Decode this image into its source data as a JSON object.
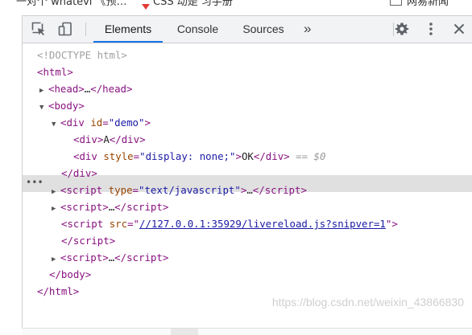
{
  "browser_tabs": {
    "fragment_left": "一对个 whatevl 《预…",
    "fragment_mid": "CSS 动是 习手册",
    "fragment_right": "网易新闻"
  },
  "devtools": {
    "tabs": [
      {
        "label": "Elements",
        "active": true
      },
      {
        "label": "Console",
        "active": false
      },
      {
        "label": "Sources",
        "active": false
      }
    ],
    "more_tabs": "»"
  },
  "tree": {
    "doctype": "<!DOCTYPE html>",
    "html_open": "html",
    "head": {
      "tag": "head",
      "collapsed": "…"
    },
    "body_open": "body",
    "div_demo": {
      "tag": "div",
      "attr": "id",
      "value": "\"demo\""
    },
    "div_a": {
      "tag": "div",
      "text": "A"
    },
    "div_ok": {
      "tag": "div",
      "attr": "style",
      "value": "\"display: none;\"",
      "text": "OK",
      "marker": "== $0"
    },
    "div_close": "/div",
    "script_js": {
      "tag": "script",
      "attr": "type",
      "value": "\"text/javascript\"",
      "collapsed": "…"
    },
    "script_2": {
      "tag": "script",
      "collapsed": "…"
    },
    "script_lr": {
      "tag": "script",
      "attr": "src",
      "value": "//127.0.0.1:35929/livereload.js?snipver=1"
    },
    "script_close": "/script",
    "script_4": {
      "tag": "script",
      "collapsed": "…"
    },
    "body_close": "/body",
    "html_close": "/html"
  },
  "watermark": "https://blog.csdn.net/weixin_43866830"
}
